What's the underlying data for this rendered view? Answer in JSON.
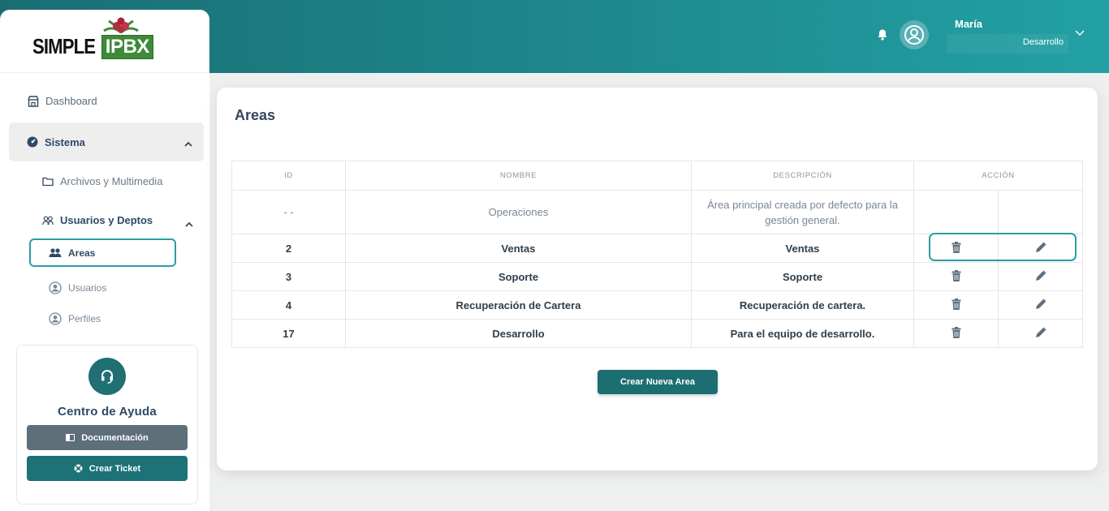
{
  "brand": {
    "logo_left": "SIMPLE",
    "logo_right": "IPBX"
  },
  "header": {
    "user_name": "María",
    "user_department": "Desarrollo"
  },
  "sidebar": {
    "dashboard": "Dashboard",
    "sistema": "Sistema",
    "archivos": "Archivos y Multimedia",
    "usuarios_deptos": "Usuarios y Deptos",
    "areas": "Areas",
    "usuarios": "Usuarios",
    "perfiles": "Perfiles"
  },
  "help": {
    "title": "Centro de Ayuda",
    "documentation": "Documentación",
    "create_ticket": "Crear Ticket"
  },
  "main": {
    "title": "Areas",
    "columns": {
      "id": "ID",
      "nombre": "NOMBRE",
      "descripcion": "DESCRIPCIÓN",
      "accion": "ACCIÓN"
    },
    "rows": [
      {
        "id": "- -",
        "nombre": "Operaciones",
        "descripcion": "Área principal creada por defecto para la gestión general."
      },
      {
        "id": "2",
        "nombre": "Ventas",
        "descripcion": "Ventas"
      },
      {
        "id": "3",
        "nombre": "Soporte",
        "descripcion": "Soporte"
      },
      {
        "id": "4",
        "nombre": "Recuperación de Cartera",
        "descripcion": "Recuperación de cartera."
      },
      {
        "id": "17",
        "nombre": "Desarrollo",
        "descripcion": "Para el equipo de desarrollo."
      }
    ],
    "create_button": "Crear Nueva Area"
  },
  "colors": {
    "accent": "#1c7276",
    "highlight_border": "#2a9ea3",
    "header_start": "#1a6e72",
    "header_end": "#22a1a4"
  }
}
